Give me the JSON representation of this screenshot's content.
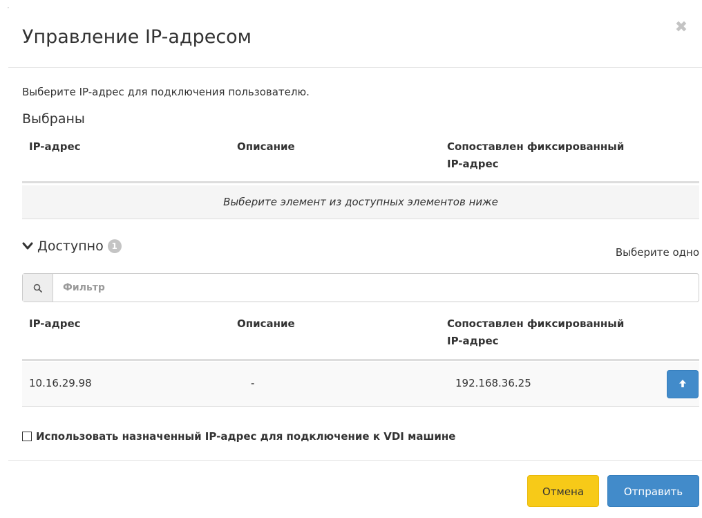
{
  "modal": {
    "title": "Управление IP-адресом",
    "close_symbol": "✖",
    "intro": "Выберите IP-адрес для подключения пользователю."
  },
  "selected": {
    "heading": "Выбраны",
    "columns": [
      "IP-адрес",
      "Описание",
      "Сопоставлен фиксированный IP-адрес"
    ],
    "empty_message": "Выберите элемент из доступных элементов ниже"
  },
  "available": {
    "heading": "Доступно",
    "count": "1",
    "select_hint": "Выберите одно",
    "filter_placeholder": "Фильтр",
    "columns": [
      "IP-адрес",
      "Описание",
      "Сопоставлен фиксированный IP-адрес"
    ],
    "rows": [
      {
        "ip": "10.16.29.98",
        "description": "-",
        "fixed_ip": "192.168.36.25"
      }
    ]
  },
  "options": {
    "use_assigned_ip_label": "Использовать назначенный IP-адрес для подключение к VDI машине",
    "use_assigned_ip_checked": false
  },
  "footer": {
    "cancel_label": "Отмена",
    "submit_label": "Отправить"
  },
  "colors": {
    "primary": "#428bca",
    "cancel": "#f7ca18",
    "badge": "#c4c4c4"
  },
  "icons": {
    "close": "close-icon",
    "chevron": "chevron-down-icon",
    "search": "search-icon",
    "allocate": "arrow-up-icon"
  }
}
